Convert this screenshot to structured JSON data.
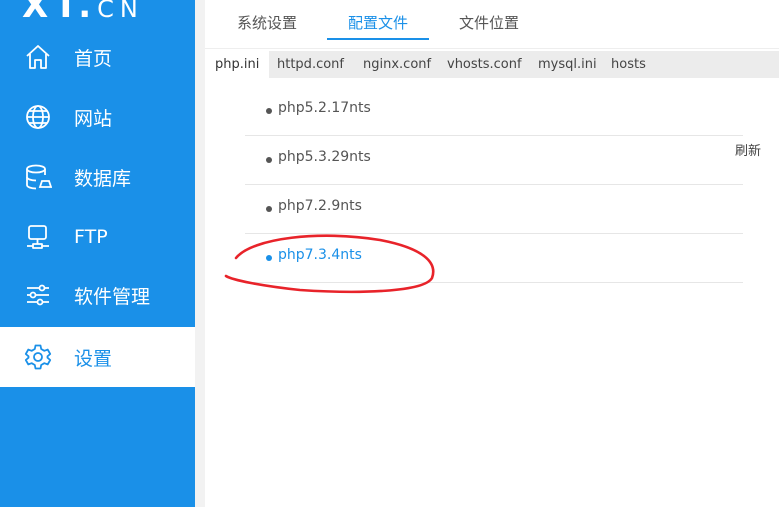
{
  "logo": {
    "big": "XT.",
    "small": "CN"
  },
  "sidebar": {
    "items": [
      {
        "label": "首页",
        "icon": "home-icon"
      },
      {
        "label": "网站",
        "icon": "globe-icon"
      },
      {
        "label": "数据库",
        "icon": "database-icon"
      },
      {
        "label": "FTP",
        "icon": "ftp-server-icon"
      },
      {
        "label": "软件管理",
        "icon": "sliders-icon"
      },
      {
        "label": "设置",
        "icon": "gear-icon",
        "active": true
      }
    ]
  },
  "top_tabs": [
    "系统设置",
    "配置文件",
    "文件位置"
  ],
  "file_tabs": [
    "php.ini",
    "httpd.conf",
    "nginx.conf",
    "vhosts.conf",
    "mysql.ini",
    "hosts"
  ],
  "refresh_label": "刷新",
  "versions": [
    "php5.2.17nts",
    "php5.3.29nts",
    "php7.2.9nts",
    "php7.3.4nts"
  ],
  "colors": {
    "accent": "#1a90e8",
    "annotation": "#e8232a"
  }
}
